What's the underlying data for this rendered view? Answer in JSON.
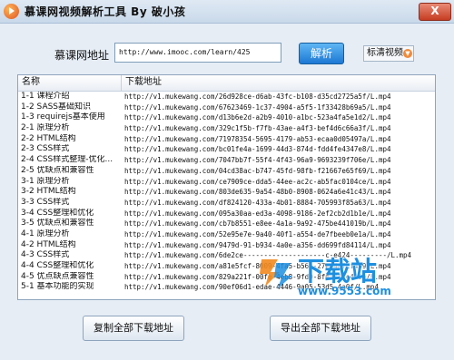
{
  "window": {
    "title": "慕课网视频解析工具 By 破小孩",
    "close_label": "X"
  },
  "form": {
    "url_label": "慕课网地址",
    "url_value": "http://www.imooc.com/learn/425",
    "parse_label": "解析",
    "quality_value": "标清视频"
  },
  "table": {
    "headers": {
      "name": "名称",
      "url": "下载地址"
    },
    "rows": [
      {
        "name": "1-1 课程介绍",
        "url": "http://v1.mukewang.com/26d928ce-d6ab-43fc-b108-d35cd2725a5f/L.mp4"
      },
      {
        "name": "1-2 SASS基础知识",
        "url": "http://v1.mukewang.com/67623469-1c37-4904-a5f5-1f33428b69a5/L.mp4"
      },
      {
        "name": "1-3 requirejs基本使用",
        "url": "http://v1.mukewang.com/d13b6e2d-a2b9-4010-a1bc-523a4fa5e1d2/L.mp4"
      },
      {
        "name": "2-1 原理分析",
        "url": "http://v1.mukewang.com/329c1f5b-f7fb-43ae-a4f3-bef4d6c66a3f/L.mp4"
      },
      {
        "name": "2-2 HTML结构",
        "url": "http://v1.mukewang.com/71978354-5695-4179-ab53-ecaa0d05497a/L.mp4"
      },
      {
        "name": "2-3 CSS样式",
        "url": "http://v1.mukewang.com/bc01fe4a-1699-44d3-874d-fdd4fe4347e8/L.mp4"
      },
      {
        "name": "2-4 CSS样式整理-优化...",
        "url": "http://v1.mukewang.com/7047bb7f-55f4-4f43-96a9-9693239f706e/L.mp4"
      },
      {
        "name": "2-5 优缺点和兼容性",
        "url": "http://v1.mukewang.com/04cd38ac-b747-45fd-98fb-f21667e65f69/L.mp4"
      },
      {
        "name": "3-1 原理分析",
        "url": "http://v1.mukewang.com/ce7909ce-dda5-44ee-ac2c-ab5fac0104ce/L.mp4"
      },
      {
        "name": "3-2 HTML结构",
        "url": "http://v1.mukewang.com/803de635-9a54-48b0-8908-0624a6e41c43/L.mp4"
      },
      {
        "name": "3-3 CSS样式",
        "url": "http://v1.mukewang.com/df824120-433a-4b01-8884-705993f85a63/L.mp4"
      },
      {
        "name": "3-4 CSS整理和优化",
        "url": "http://v1.mukewang.com/095a30aa-ed3a-4098-9186-2ef2cb2d1b1e/L.mp4"
      },
      {
        "name": "3-5 优缺点和兼容性",
        "url": "http://v1.mukewang.com/cb7b8551-e8ee-4a1a-9a92-475be441019b/L.mp4"
      },
      {
        "name": "4-1 原理分析",
        "url": "http://v1.mukewang.com/52e95e7e-9a40-40f1-a554-de7fbeeb0e1a/L.mp4"
      },
      {
        "name": "4-2 HTML结构",
        "url": "http://v1.mukewang.com/9479d-91-b934-4a0e-a356-dd699fd84114/L.mp4"
      },
      {
        "name": "4-3 CSS样式",
        "url": "http://v1.mukewang.com/6de2ce--------------------c-e424---------/L.mp4"
      },
      {
        "name": "4-4 CSS整理和优化",
        "url": "http://v1.mukewang.com/a81e5fcf-8009-4fa5-b56c-27ef4a7cf4b9/L.mp4"
      },
      {
        "name": "4-5 优点缺点兼容性",
        "url": "http://v1.mukewang.com/829a221f-00fe-4eb8-9fd9-8f0371fe4a5a/L.mp4"
      },
      {
        "name": "5-1 基本功能的实现",
        "url": "http://v1.mukewang.com/90ef06d1-edae-4446-9a05-53d5-4a0f/L.mp4"
      }
    ]
  },
  "actions": {
    "copy_all_label": "复制全部下载地址",
    "export_all_label": "导出全部下载地址"
  },
  "watermark": {
    "text": "下载站",
    "sub": "www.9553.com"
  }
}
